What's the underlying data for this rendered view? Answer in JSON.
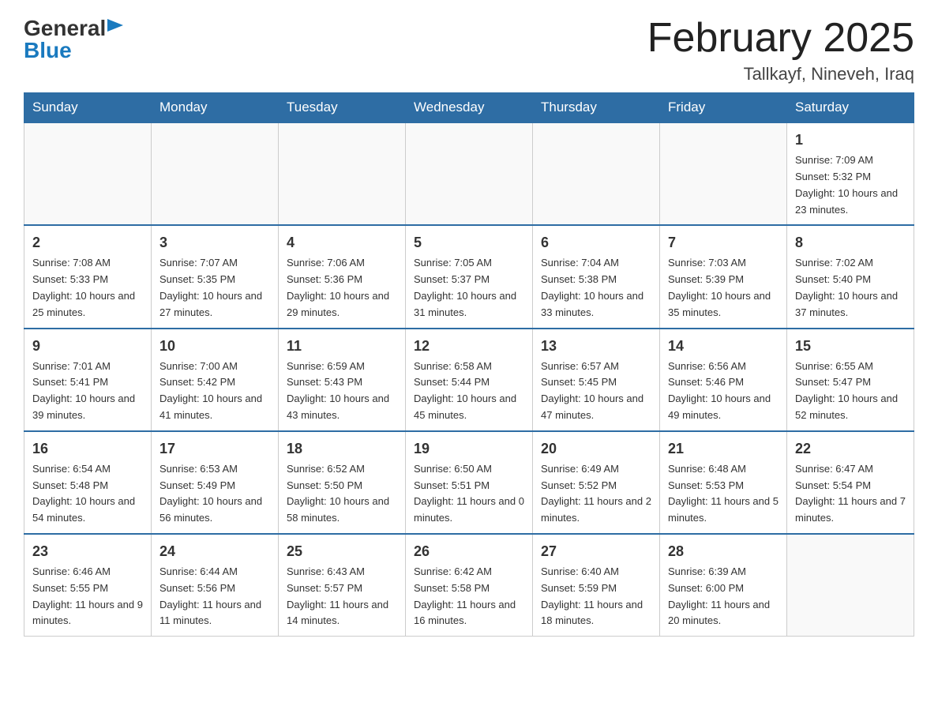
{
  "header": {
    "title": "February 2025",
    "subtitle": "Tallkayf, Nineveh, Iraq",
    "logo": {
      "general": "General",
      "blue": "Blue"
    }
  },
  "weekdays": [
    "Sunday",
    "Monday",
    "Tuesday",
    "Wednesday",
    "Thursday",
    "Friday",
    "Saturday"
  ],
  "weeks": [
    [
      {
        "day": "",
        "info": ""
      },
      {
        "day": "",
        "info": ""
      },
      {
        "day": "",
        "info": ""
      },
      {
        "day": "",
        "info": ""
      },
      {
        "day": "",
        "info": ""
      },
      {
        "day": "",
        "info": ""
      },
      {
        "day": "1",
        "info": "Sunrise: 7:09 AM\nSunset: 5:32 PM\nDaylight: 10 hours and 23 minutes."
      }
    ],
    [
      {
        "day": "2",
        "info": "Sunrise: 7:08 AM\nSunset: 5:33 PM\nDaylight: 10 hours and 25 minutes."
      },
      {
        "day": "3",
        "info": "Sunrise: 7:07 AM\nSunset: 5:35 PM\nDaylight: 10 hours and 27 minutes."
      },
      {
        "day": "4",
        "info": "Sunrise: 7:06 AM\nSunset: 5:36 PM\nDaylight: 10 hours and 29 minutes."
      },
      {
        "day": "5",
        "info": "Sunrise: 7:05 AM\nSunset: 5:37 PM\nDaylight: 10 hours and 31 minutes."
      },
      {
        "day": "6",
        "info": "Sunrise: 7:04 AM\nSunset: 5:38 PM\nDaylight: 10 hours and 33 minutes."
      },
      {
        "day": "7",
        "info": "Sunrise: 7:03 AM\nSunset: 5:39 PM\nDaylight: 10 hours and 35 minutes."
      },
      {
        "day": "8",
        "info": "Sunrise: 7:02 AM\nSunset: 5:40 PM\nDaylight: 10 hours and 37 minutes."
      }
    ],
    [
      {
        "day": "9",
        "info": "Sunrise: 7:01 AM\nSunset: 5:41 PM\nDaylight: 10 hours and 39 minutes."
      },
      {
        "day": "10",
        "info": "Sunrise: 7:00 AM\nSunset: 5:42 PM\nDaylight: 10 hours and 41 minutes."
      },
      {
        "day": "11",
        "info": "Sunrise: 6:59 AM\nSunset: 5:43 PM\nDaylight: 10 hours and 43 minutes."
      },
      {
        "day": "12",
        "info": "Sunrise: 6:58 AM\nSunset: 5:44 PM\nDaylight: 10 hours and 45 minutes."
      },
      {
        "day": "13",
        "info": "Sunrise: 6:57 AM\nSunset: 5:45 PM\nDaylight: 10 hours and 47 minutes."
      },
      {
        "day": "14",
        "info": "Sunrise: 6:56 AM\nSunset: 5:46 PM\nDaylight: 10 hours and 49 minutes."
      },
      {
        "day": "15",
        "info": "Sunrise: 6:55 AM\nSunset: 5:47 PM\nDaylight: 10 hours and 52 minutes."
      }
    ],
    [
      {
        "day": "16",
        "info": "Sunrise: 6:54 AM\nSunset: 5:48 PM\nDaylight: 10 hours and 54 minutes."
      },
      {
        "day": "17",
        "info": "Sunrise: 6:53 AM\nSunset: 5:49 PM\nDaylight: 10 hours and 56 minutes."
      },
      {
        "day": "18",
        "info": "Sunrise: 6:52 AM\nSunset: 5:50 PM\nDaylight: 10 hours and 58 minutes."
      },
      {
        "day": "19",
        "info": "Sunrise: 6:50 AM\nSunset: 5:51 PM\nDaylight: 11 hours and 0 minutes."
      },
      {
        "day": "20",
        "info": "Sunrise: 6:49 AM\nSunset: 5:52 PM\nDaylight: 11 hours and 2 minutes."
      },
      {
        "day": "21",
        "info": "Sunrise: 6:48 AM\nSunset: 5:53 PM\nDaylight: 11 hours and 5 minutes."
      },
      {
        "day": "22",
        "info": "Sunrise: 6:47 AM\nSunset: 5:54 PM\nDaylight: 11 hours and 7 minutes."
      }
    ],
    [
      {
        "day": "23",
        "info": "Sunrise: 6:46 AM\nSunset: 5:55 PM\nDaylight: 11 hours and 9 minutes."
      },
      {
        "day": "24",
        "info": "Sunrise: 6:44 AM\nSunset: 5:56 PM\nDaylight: 11 hours and 11 minutes."
      },
      {
        "day": "25",
        "info": "Sunrise: 6:43 AM\nSunset: 5:57 PM\nDaylight: 11 hours and 14 minutes."
      },
      {
        "day": "26",
        "info": "Sunrise: 6:42 AM\nSunset: 5:58 PM\nDaylight: 11 hours and 16 minutes."
      },
      {
        "day": "27",
        "info": "Sunrise: 6:40 AM\nSunset: 5:59 PM\nDaylight: 11 hours and 18 minutes."
      },
      {
        "day": "28",
        "info": "Sunrise: 6:39 AM\nSunset: 6:00 PM\nDaylight: 11 hours and 20 minutes."
      },
      {
        "day": "",
        "info": ""
      }
    ]
  ]
}
